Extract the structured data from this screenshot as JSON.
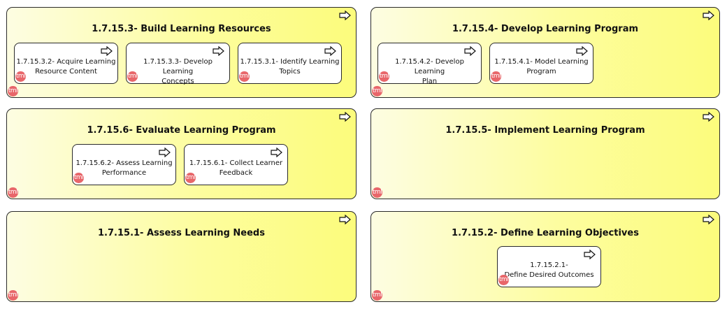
{
  "icons": {
    "group_corner": "arrow-right-icon",
    "badge": "tml-badge"
  },
  "colors": {
    "group_fill_start": "#fdfde2",
    "group_fill_end": "#fcfc7c",
    "badge": "#e8666a",
    "border": "#2a2a2a"
  },
  "badge_text": "tml",
  "groups": [
    {
      "title": "1.7.15.3- Build Learning Resources",
      "processes": [
        {
          "line1": "1.7.15.3.2- Acquire Learning",
          "line2": "Resource Content"
        },
        {
          "line1": "1.7.15.3.3- Develop Learning",
          "line2": "Concepts"
        },
        {
          "line1": "1.7.15.3.1- Identify Learning",
          "line2": "Topics"
        }
      ]
    },
    {
      "title": "1.7.15.4- Develop Learning Program",
      "processes": [
        {
          "line1": "1.7.15.4.2- Develop Learning",
          "line2": "Plan"
        },
        {
          "line1": "1.7.15.4.1- Model Learning",
          "line2": "Program"
        }
      ]
    },
    {
      "title": "1.7.15.6- Evaluate Learning Program",
      "processes": [
        {
          "line1": "1.7.15.6.2- Assess Learning",
          "line2": "Performance"
        },
        {
          "line1": "1.7.15.6.1- Collect Learner",
          "line2": "Feedback"
        }
      ]
    },
    {
      "title": "1.7.15.5- Implement Learning Program",
      "processes": []
    },
    {
      "title": "1.7.15.1- Assess Learning Needs",
      "processes": []
    },
    {
      "title": "1.7.15.2- Define Learning Objectives",
      "processes": [
        {
          "line1": "1.7.15.2.1-",
          "line2": "Define Desired Outcomes"
        }
      ]
    }
  ]
}
